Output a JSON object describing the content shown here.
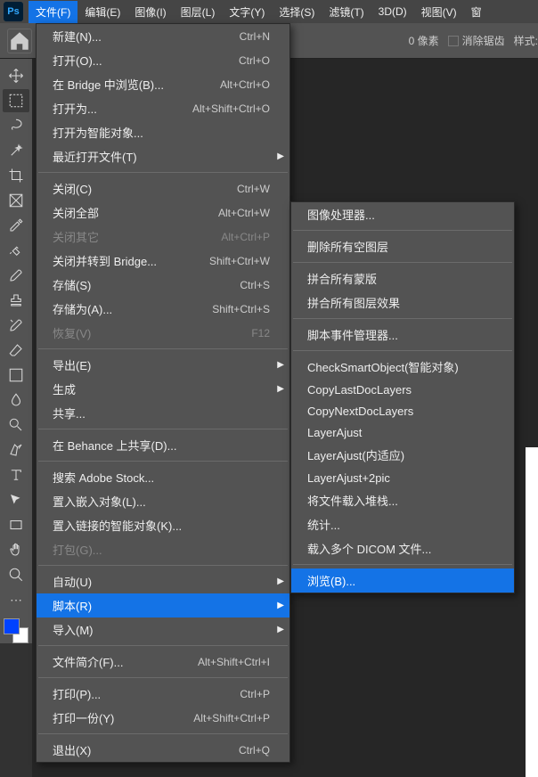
{
  "logo": "Ps",
  "menubar": [
    "文件(F)",
    "编辑(E)",
    "图像(I)",
    "图层(L)",
    "文字(Y)",
    "选择(S)",
    "滤镜(T)",
    "3D(D)",
    "视图(V)",
    "窗"
  ],
  "options": {
    "pixel_label": "0 像素",
    "antialias": "消除锯齿",
    "style": "样式:"
  },
  "file_menu": [
    {
      "type": "item",
      "label": "新建(N)...",
      "shortcut": "Ctrl+N"
    },
    {
      "type": "item",
      "label": "打开(O)...",
      "shortcut": "Ctrl+O"
    },
    {
      "type": "item",
      "label": "在 Bridge 中浏览(B)...",
      "shortcut": "Alt+Ctrl+O"
    },
    {
      "type": "item",
      "label": "打开为...",
      "shortcut": "Alt+Shift+Ctrl+O"
    },
    {
      "type": "item",
      "label": "打开为智能对象..."
    },
    {
      "type": "item",
      "label": "最近打开文件(T)",
      "submenu": true
    },
    {
      "type": "sep"
    },
    {
      "type": "item",
      "label": "关闭(C)",
      "shortcut": "Ctrl+W"
    },
    {
      "type": "item",
      "label": "关闭全部",
      "shortcut": "Alt+Ctrl+W"
    },
    {
      "type": "item",
      "label": "关闭其它",
      "shortcut": "Alt+Ctrl+P",
      "disabled": true
    },
    {
      "type": "item",
      "label": "关闭并转到 Bridge...",
      "shortcut": "Shift+Ctrl+W"
    },
    {
      "type": "item",
      "label": "存储(S)",
      "shortcut": "Ctrl+S"
    },
    {
      "type": "item",
      "label": "存储为(A)...",
      "shortcut": "Shift+Ctrl+S"
    },
    {
      "type": "item",
      "label": "恢复(V)",
      "shortcut": "F12",
      "disabled": true
    },
    {
      "type": "sep"
    },
    {
      "type": "item",
      "label": "导出(E)",
      "submenu": true
    },
    {
      "type": "item",
      "label": "生成",
      "submenu": true
    },
    {
      "type": "item",
      "label": "共享..."
    },
    {
      "type": "sep"
    },
    {
      "type": "item",
      "label": "在 Behance 上共享(D)..."
    },
    {
      "type": "sep"
    },
    {
      "type": "item",
      "label": "搜索 Adobe Stock..."
    },
    {
      "type": "item",
      "label": "置入嵌入对象(L)..."
    },
    {
      "type": "item",
      "label": "置入链接的智能对象(K)..."
    },
    {
      "type": "item",
      "label": "打包(G)...",
      "disabled": true
    },
    {
      "type": "sep"
    },
    {
      "type": "item",
      "label": "自动(U)",
      "submenu": true
    },
    {
      "type": "item",
      "label": "脚本(R)",
      "submenu": true,
      "highlight": true
    },
    {
      "type": "item",
      "label": "导入(M)",
      "submenu": true
    },
    {
      "type": "sep"
    },
    {
      "type": "item",
      "label": "文件简介(F)...",
      "shortcut": "Alt+Shift+Ctrl+I"
    },
    {
      "type": "sep"
    },
    {
      "type": "item",
      "label": "打印(P)...",
      "shortcut": "Ctrl+P"
    },
    {
      "type": "item",
      "label": "打印一份(Y)",
      "shortcut": "Alt+Shift+Ctrl+P"
    },
    {
      "type": "sep"
    },
    {
      "type": "item",
      "label": "退出(X)",
      "shortcut": "Ctrl+Q"
    }
  ],
  "script_menu": [
    {
      "type": "item",
      "label": "图像处理器..."
    },
    {
      "type": "sep"
    },
    {
      "type": "item",
      "label": "删除所有空图层"
    },
    {
      "type": "sep"
    },
    {
      "type": "item",
      "label": "拼合所有蒙版"
    },
    {
      "type": "item",
      "label": "拼合所有图层效果"
    },
    {
      "type": "sep"
    },
    {
      "type": "item",
      "label": "脚本事件管理器..."
    },
    {
      "type": "sep"
    },
    {
      "type": "item",
      "label": "CheckSmartObject(智能对象)"
    },
    {
      "type": "item",
      "label": "CopyLastDocLayers"
    },
    {
      "type": "item",
      "label": "CopyNextDocLayers"
    },
    {
      "type": "item",
      "label": "LayerAjust"
    },
    {
      "type": "item",
      "label": "LayerAjust(内适应)"
    },
    {
      "type": "item",
      "label": "LayerAjust+2pic"
    },
    {
      "type": "item",
      "label": "将文件载入堆栈..."
    },
    {
      "type": "item",
      "label": "统计..."
    },
    {
      "type": "item",
      "label": "载入多个 DICOM 文件..."
    },
    {
      "type": "sep"
    },
    {
      "type": "item",
      "label": "浏览(B)...",
      "highlight": true
    }
  ]
}
